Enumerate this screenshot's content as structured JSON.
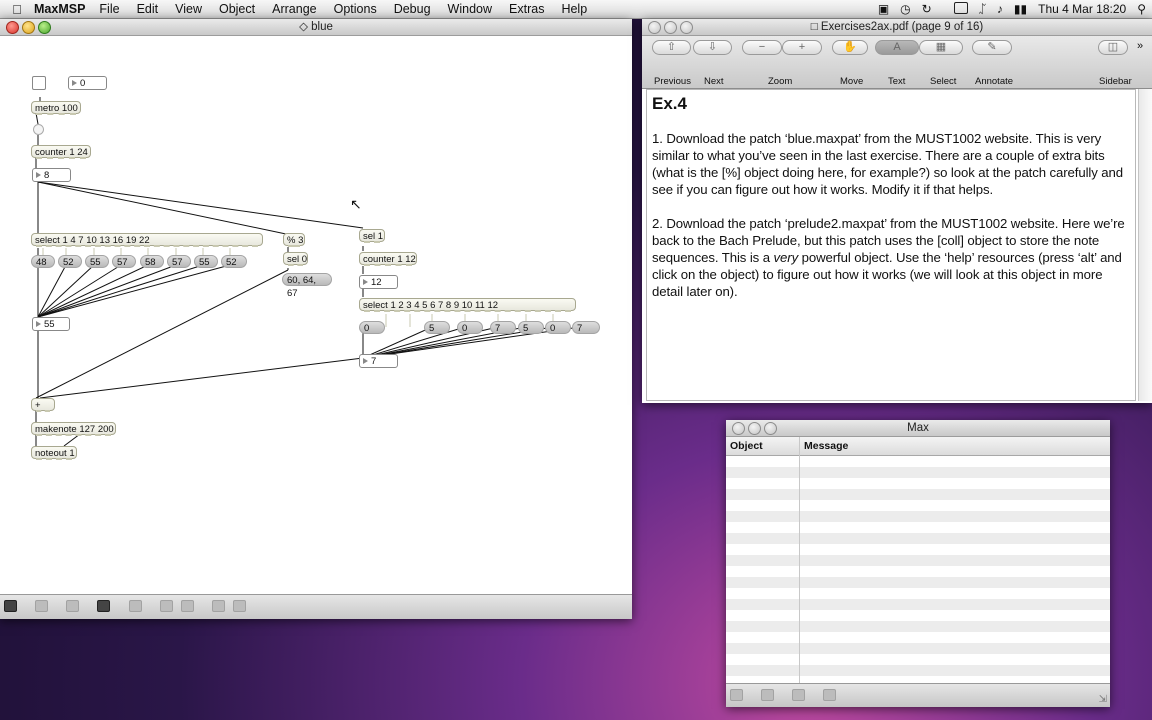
{
  "menubar": {
    "app": "MaxMSP",
    "items": [
      "File",
      "Edit",
      "View",
      "Object",
      "Arrange",
      "Options",
      "Debug",
      "Window",
      "Extras",
      "Help"
    ],
    "clock": "Thu 4 Mar  18:20"
  },
  "patcher": {
    "title": "blue",
    "objects": {
      "number_top": "0",
      "metro": "metro 100",
      "counter_24": "counter 1 24",
      "num_8": "8",
      "select_main": "select 1 4 7 10 13 16 19 22",
      "mod3": "% 3",
      "sel1": "sel 1",
      "sel0": "sel 0",
      "counter_12": "counter 1 12",
      "chord_msg": "60, 64, 67",
      "num_12": "12",
      "select_12": "select 1 2 3 4 5 6 7 8 9 10 11 12",
      "num_55": "55",
      "num_7": "7",
      "plus": "+",
      "makenote": "makenote 127 200",
      "noteout": "noteout 1"
    },
    "messages_top": [
      "48",
      "52",
      "55",
      "57",
      "58",
      "57",
      "55",
      "52"
    ],
    "messages_right": [
      "0",
      "5",
      "0",
      "7",
      "5",
      "0",
      "7"
    ]
  },
  "preview": {
    "title": "Exercises2ax.pdf (page 9 of 16)",
    "toolbar": {
      "previous": "Previous",
      "next": "Next",
      "zoom": "Zoom",
      "move": "Move",
      "text": "Text",
      "select": "Select",
      "annotate": "Annotate",
      "sidebar": "Sidebar"
    },
    "doc": {
      "heading": "Ex.4",
      "para1": "1. Download the patch ‘blue.maxpat’ from the MUST1002 website. This is very similar to what you’ve seen in the last exercise. There are a couple of extra bits (what is the [%] object doing here, for example?) so look at the patch carefully and see if you can figure out how it works. Modify it if that helps.",
      "para2_a": "2. Download the patch ‘prelude2.maxpat’ from the MUST1002 website. Here we’re back to the Bach Prelude, but this patch uses the [coll] object to store the note sequences. This is a ",
      "para2_em": "very",
      "para2_b": " powerful object. Use the ‘help’ resources (press ‘alt’ and click on the object) to figure out how it works (we will look at this object in more detail later on)."
    }
  },
  "console": {
    "title": "Max",
    "col_object": "Object",
    "col_message": "Message"
  }
}
